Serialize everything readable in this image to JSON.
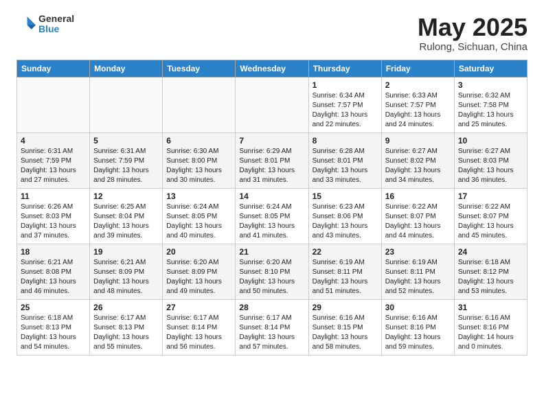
{
  "header": {
    "logo_line1": "General",
    "logo_line2": "Blue",
    "month_title": "May 2025",
    "location": "Rulong, Sichuan, China"
  },
  "weekdays": [
    "Sunday",
    "Monday",
    "Tuesday",
    "Wednesday",
    "Thursday",
    "Friday",
    "Saturday"
  ],
  "weeks": [
    [
      {
        "day": "",
        "info": ""
      },
      {
        "day": "",
        "info": ""
      },
      {
        "day": "",
        "info": ""
      },
      {
        "day": "",
        "info": ""
      },
      {
        "day": "1",
        "info": "Sunrise: 6:34 AM\nSunset: 7:57 PM\nDaylight: 13 hours\nand 22 minutes."
      },
      {
        "day": "2",
        "info": "Sunrise: 6:33 AM\nSunset: 7:57 PM\nDaylight: 13 hours\nand 24 minutes."
      },
      {
        "day": "3",
        "info": "Sunrise: 6:32 AM\nSunset: 7:58 PM\nDaylight: 13 hours\nand 25 minutes."
      }
    ],
    [
      {
        "day": "4",
        "info": "Sunrise: 6:31 AM\nSunset: 7:59 PM\nDaylight: 13 hours\nand 27 minutes."
      },
      {
        "day": "5",
        "info": "Sunrise: 6:31 AM\nSunset: 7:59 PM\nDaylight: 13 hours\nand 28 minutes."
      },
      {
        "day": "6",
        "info": "Sunrise: 6:30 AM\nSunset: 8:00 PM\nDaylight: 13 hours\nand 30 minutes."
      },
      {
        "day": "7",
        "info": "Sunrise: 6:29 AM\nSunset: 8:01 PM\nDaylight: 13 hours\nand 31 minutes."
      },
      {
        "day": "8",
        "info": "Sunrise: 6:28 AM\nSunset: 8:01 PM\nDaylight: 13 hours\nand 33 minutes."
      },
      {
        "day": "9",
        "info": "Sunrise: 6:27 AM\nSunset: 8:02 PM\nDaylight: 13 hours\nand 34 minutes."
      },
      {
        "day": "10",
        "info": "Sunrise: 6:27 AM\nSunset: 8:03 PM\nDaylight: 13 hours\nand 36 minutes."
      }
    ],
    [
      {
        "day": "11",
        "info": "Sunrise: 6:26 AM\nSunset: 8:03 PM\nDaylight: 13 hours\nand 37 minutes."
      },
      {
        "day": "12",
        "info": "Sunrise: 6:25 AM\nSunset: 8:04 PM\nDaylight: 13 hours\nand 39 minutes."
      },
      {
        "day": "13",
        "info": "Sunrise: 6:24 AM\nSunset: 8:05 PM\nDaylight: 13 hours\nand 40 minutes."
      },
      {
        "day": "14",
        "info": "Sunrise: 6:24 AM\nSunset: 8:05 PM\nDaylight: 13 hours\nand 41 minutes."
      },
      {
        "day": "15",
        "info": "Sunrise: 6:23 AM\nSunset: 8:06 PM\nDaylight: 13 hours\nand 43 minutes."
      },
      {
        "day": "16",
        "info": "Sunrise: 6:22 AM\nSunset: 8:07 PM\nDaylight: 13 hours\nand 44 minutes."
      },
      {
        "day": "17",
        "info": "Sunrise: 6:22 AM\nSunset: 8:07 PM\nDaylight: 13 hours\nand 45 minutes."
      }
    ],
    [
      {
        "day": "18",
        "info": "Sunrise: 6:21 AM\nSunset: 8:08 PM\nDaylight: 13 hours\nand 46 minutes."
      },
      {
        "day": "19",
        "info": "Sunrise: 6:21 AM\nSunset: 8:09 PM\nDaylight: 13 hours\nand 48 minutes."
      },
      {
        "day": "20",
        "info": "Sunrise: 6:20 AM\nSunset: 8:09 PM\nDaylight: 13 hours\nand 49 minutes."
      },
      {
        "day": "21",
        "info": "Sunrise: 6:20 AM\nSunset: 8:10 PM\nDaylight: 13 hours\nand 50 minutes."
      },
      {
        "day": "22",
        "info": "Sunrise: 6:19 AM\nSunset: 8:11 PM\nDaylight: 13 hours\nand 51 minutes."
      },
      {
        "day": "23",
        "info": "Sunrise: 6:19 AM\nSunset: 8:11 PM\nDaylight: 13 hours\nand 52 minutes."
      },
      {
        "day": "24",
        "info": "Sunrise: 6:18 AM\nSunset: 8:12 PM\nDaylight: 13 hours\nand 53 minutes."
      }
    ],
    [
      {
        "day": "25",
        "info": "Sunrise: 6:18 AM\nSunset: 8:13 PM\nDaylight: 13 hours\nand 54 minutes."
      },
      {
        "day": "26",
        "info": "Sunrise: 6:17 AM\nSunset: 8:13 PM\nDaylight: 13 hours\nand 55 minutes."
      },
      {
        "day": "27",
        "info": "Sunrise: 6:17 AM\nSunset: 8:14 PM\nDaylight: 13 hours\nand 56 minutes."
      },
      {
        "day": "28",
        "info": "Sunrise: 6:17 AM\nSunset: 8:14 PM\nDaylight: 13 hours\nand 57 minutes."
      },
      {
        "day": "29",
        "info": "Sunrise: 6:16 AM\nSunset: 8:15 PM\nDaylight: 13 hours\nand 58 minutes."
      },
      {
        "day": "30",
        "info": "Sunrise: 6:16 AM\nSunset: 8:16 PM\nDaylight: 13 hours\nand 59 minutes."
      },
      {
        "day": "31",
        "info": "Sunrise: 6:16 AM\nSunset: 8:16 PM\nDaylight: 14 hours\nand 0 minutes."
      }
    ]
  ]
}
